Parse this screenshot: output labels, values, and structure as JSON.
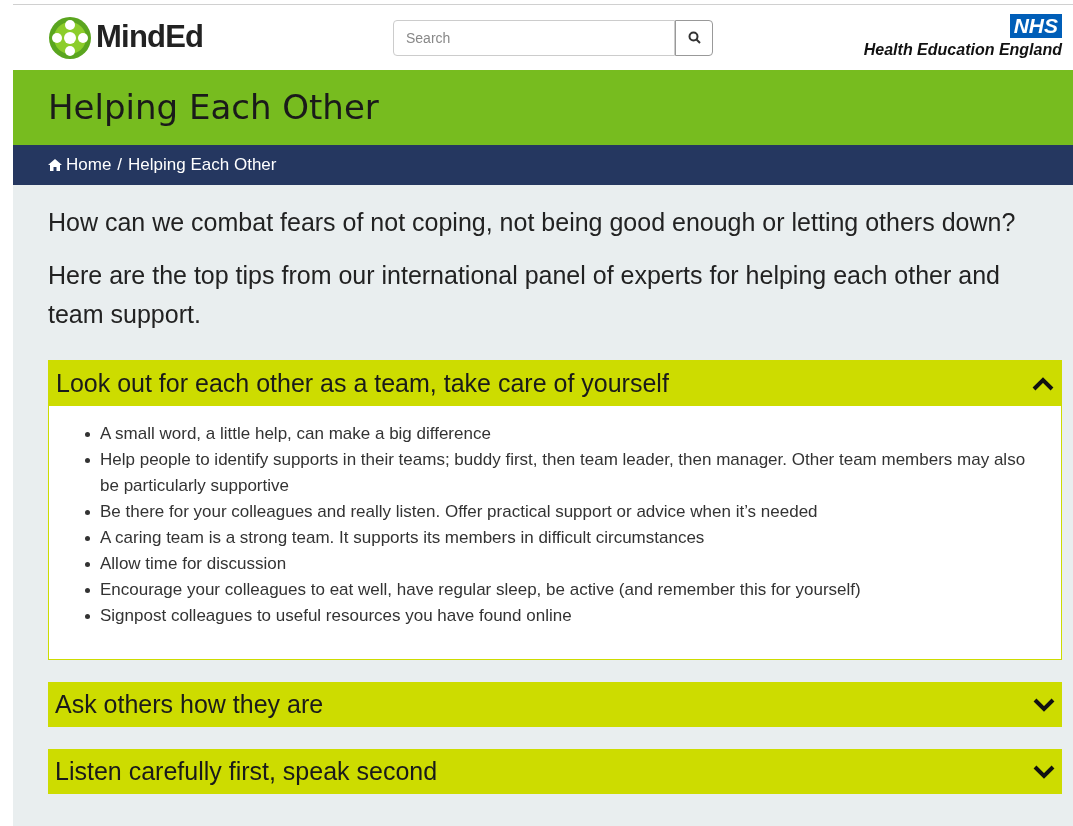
{
  "header": {
    "logo_text": "MindEd",
    "search": {
      "placeholder": "Search"
    },
    "partner": {
      "badge": "NHS",
      "name": "Health Education England"
    }
  },
  "banner": {
    "title": "Helping Each Other"
  },
  "breadcrumb": [
    {
      "label": "Home"
    },
    {
      "label": "Helping Each Other"
    }
  ],
  "breadcrumb_separator": "/",
  "intro": [
    "How can we combat fears of not coping, not being good enough or letting others down?",
    "Here are the top tips from our international panel of experts for helping each other and team support."
  ],
  "accordion": [
    {
      "title": "Look out for each other as a team, take care of yourself",
      "expanded": true,
      "items": [
        "A small word, a little help, can make a big difference",
        "Help people to identify supports in their teams; buddy first, then team leader, then manager. Other team members may also be particularly supportive",
        "Be there for your colleagues and really listen. Offer practical support or advice when it’s needed",
        "A caring team is a strong team. It supports its members in difficult circumstances",
        "Allow time for discussion",
        "Encourage your colleagues to eat well, have regular sleep, be active (and remember this for yourself)",
        "Signpost colleagues to useful resources you have found online"
      ]
    },
    {
      "title": "Ask others how they are",
      "expanded": false
    },
    {
      "title": "Listen carefully first, speak second",
      "expanded": false
    }
  ]
}
